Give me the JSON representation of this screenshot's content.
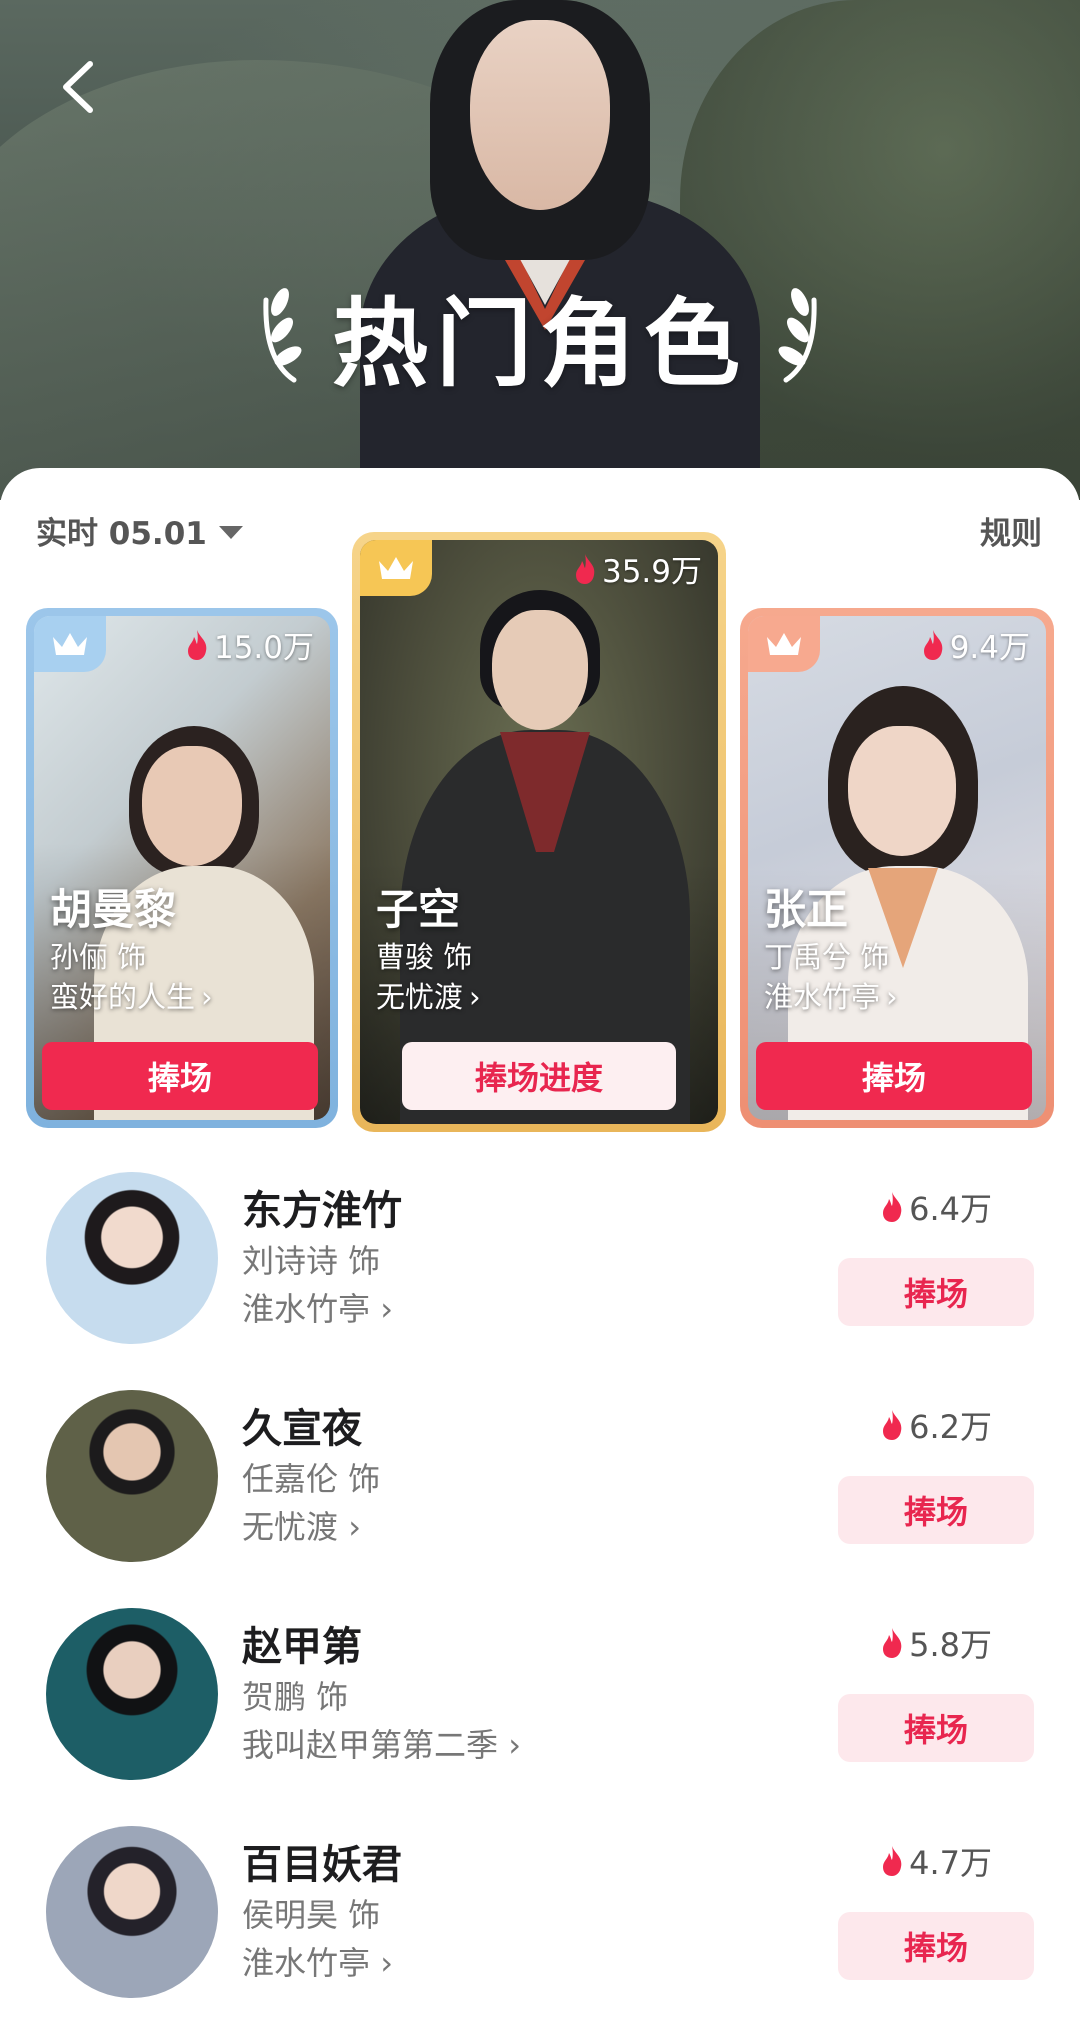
{
  "header": {
    "title": "热门角色"
  },
  "filter": {
    "date_label": "实时 05.01",
    "rules_label": "规则"
  },
  "top_cards": [
    {
      "rank_position": "left",
      "heat": "15.0万",
      "role": "胡曼黎",
      "actor": "孙俪 饰",
      "drama": "蛮好的人生",
      "button": "捧场"
    },
    {
      "rank_position": "center",
      "heat": "35.9万",
      "role": "子空",
      "actor": "曹骏 饰",
      "drama": "无忧渡",
      "button": "捧场进度"
    },
    {
      "rank_position": "right",
      "heat": "9.4万",
      "role": "张正",
      "actor": "丁禹兮 饰",
      "drama": "淮水竹亭",
      "button": "捧场"
    }
  ],
  "list": [
    {
      "role": "东方淮竹",
      "actor": "刘诗诗 饰",
      "drama": "淮水竹亭",
      "heat": "6.4万",
      "button": "捧场"
    },
    {
      "role": "久宣夜",
      "actor": "任嘉伦 饰",
      "drama": "无忧渡",
      "heat": "6.2万",
      "button": "捧场"
    },
    {
      "role": "赵甲第",
      "actor": "贺鹏 饰",
      "drama": "我叫赵甲第第二季",
      "heat": "5.8万",
      "button": "捧场"
    },
    {
      "role": "百目妖君",
      "actor": "侯明昊 饰",
      "drama": "淮水竹亭",
      "heat": "4.7万",
      "button": "捧场"
    }
  ],
  "colors": {
    "accent": "#f0294f",
    "cheer_light_bg": "#fde8ec",
    "gold": "#f2c25a",
    "blue": "#8fbde6",
    "coral": "#f29a7e"
  },
  "icons": {
    "back": "chevron-left-icon",
    "heat": "flame-icon",
    "rank": "crown-icon",
    "laurel": "laurel-icon"
  }
}
